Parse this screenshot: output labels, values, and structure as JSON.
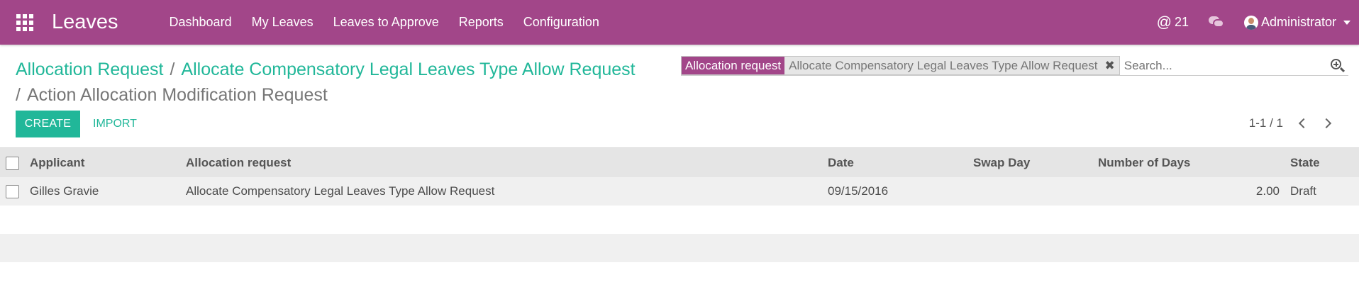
{
  "app": {
    "brand": "Leaves",
    "menu": [
      "Dashboard",
      "My Leaves",
      "Leaves to Approve",
      "Reports",
      "Configuration"
    ],
    "mentions_count": "21",
    "user_name": "Administrator",
    "accent_color": "#a24689",
    "primary_color": "#21b799"
  },
  "breadcrumb": {
    "item1": "Allocation Request",
    "item2": "Allocate Compensatory Legal Leaves Type Allow Request",
    "current": "Action Allocation Modification Request",
    "separator": "/"
  },
  "search": {
    "facet_label": "Allocation request",
    "facet_value": "Allocate Compensatory Legal Leaves Type Allow Request",
    "facet_remove": "✖",
    "placeholder": "Search..."
  },
  "buttons": {
    "create": "CREATE",
    "import": "IMPORT"
  },
  "pager": {
    "text": "1-1 / 1"
  },
  "table": {
    "columns": {
      "applicant": "Applicant",
      "allocation_request": "Allocation request",
      "date": "Date",
      "swap_day": "Swap Day",
      "number_of_days": "Number of Days",
      "state": "State"
    },
    "rows": [
      {
        "applicant": "Gilles Gravie",
        "allocation_request": "Allocate Compensatory Legal Leaves Type Allow Request",
        "date": "09/15/2016",
        "swap_day": "",
        "number_of_days": "2.00",
        "state": "Draft"
      }
    ]
  }
}
